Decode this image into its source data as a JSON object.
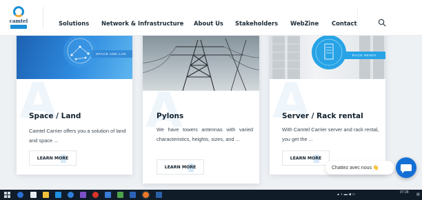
{
  "brand": {
    "logo_text": "camtel",
    "logo_sub": "carrier"
  },
  "nav": {
    "items": [
      "Solutions",
      "Network & Infrastructure",
      "About Us",
      "Stakeholders",
      "WebZine",
      "Contact"
    ]
  },
  "cards": [
    {
      "title": "Space / Land",
      "banner": "SPACE AND LAN",
      "text": "Camtel Carrier offers you a solution of land and space ...",
      "button": "LEARN MORE"
    },
    {
      "title": "Pylons",
      "banner": "",
      "text": "We have towers antennas with varied characteristics, heights, sizes, and ...",
      "button": "LEARN MORE"
    },
    {
      "title": "Server / Rack rental",
      "banner": "RACK RENTA",
      "text": "With Camtel Carrier server and rack rental, you get the ...",
      "button": "LEARN MORE"
    }
  ],
  "chat": {
    "label": "Chattez avec nous 👋"
  },
  "taskbar": {
    "time": "07:28",
    "date": "",
    "lang": ""
  },
  "colors": {
    "accent": "#1b8fd6",
    "chat": "#1570d6",
    "taskbar": "#101c28"
  }
}
